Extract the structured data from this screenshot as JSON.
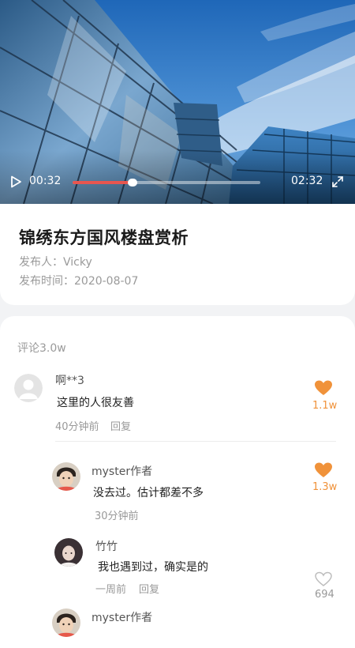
{
  "video": {
    "current_time": "00:32",
    "total_time": "02:32",
    "progress": 0.2
  },
  "post": {
    "title": "锦绣东方国风楼盘赏析",
    "publisher_label": "发布人：",
    "publisher": "Vicky",
    "time_label": "发布时间：",
    "publish_time": "2020-08-07"
  },
  "comments_section": {
    "count_label": "评论3.0w",
    "items": [
      {
        "name": "啊**3",
        "text": "这里的人很友善",
        "time": "40分钟前",
        "reply": "回复",
        "likes": "1.1w",
        "liked": true,
        "avatar": "default-avatar-icon"
      },
      {
        "name": "myster作者",
        "text": "没去过。估计都差不多",
        "time": "30分钟前",
        "likes": "1.3w",
        "liked": true,
        "avatar": "child-photo-avatar"
      },
      {
        "name": "竹竹",
        "text": "我也遇到过，确实是的",
        "time": "一周前",
        "reply": "回复",
        "likes": "694",
        "liked": false,
        "avatar": "woman-photo-avatar"
      },
      {
        "name": "myster作者",
        "avatar": "child-photo-avatar"
      }
    ]
  },
  "colors": {
    "accent_like": "#f0923a",
    "progress": "#e8564f",
    "muted_text": "#9a9a9a"
  }
}
